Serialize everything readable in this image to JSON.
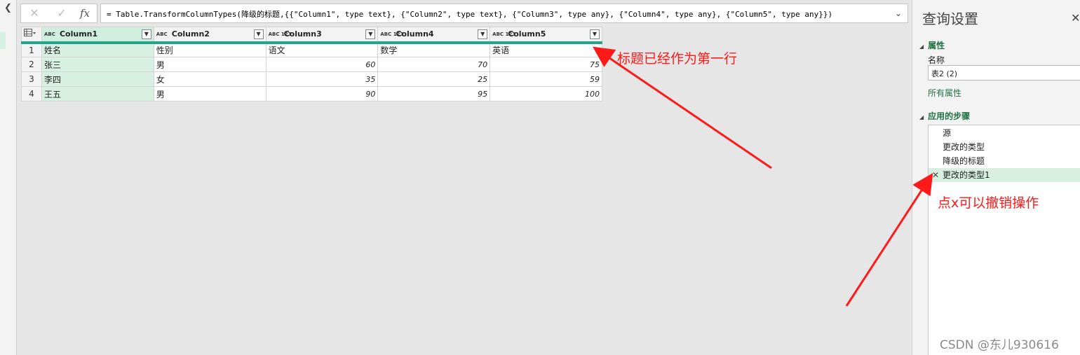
{
  "formula_bar": {
    "cancel_icon": "close-icon",
    "confirm_icon": "check-icon",
    "fx_label": "fx",
    "formula": "= Table.TransformColumnTypes(降级的标题,{{\"Column1\", type text}, {\"Column2\", type text}, {\"Column3\", type any}, {\"Column4\", type any}, {\"Column5\", type any}})"
  },
  "grid": {
    "columns": [
      {
        "type_label": "ABC",
        "name": "Column1"
      },
      {
        "type_label": "ABC",
        "name": "Column2"
      },
      {
        "type_label": "ABC 123",
        "name": "Column3"
      },
      {
        "type_label": "ABC 123",
        "name": "Column4"
      },
      {
        "type_label": "ABC 123",
        "name": "Column5"
      }
    ],
    "rows": [
      {
        "n": "1",
        "cells": [
          "姓名",
          "性别",
          "语文",
          "数学",
          "英语"
        ]
      },
      {
        "n": "2",
        "cells": [
          "张三",
          "男",
          "60",
          "70",
          "75"
        ]
      },
      {
        "n": "3",
        "cells": [
          "李四",
          "女",
          "35",
          "25",
          "59"
        ]
      },
      {
        "n": "4",
        "cells": [
          "王五",
          "男",
          "90",
          "95",
          "100"
        ]
      }
    ]
  },
  "annotations": {
    "header_note": "标题已经作为第一行",
    "undo_note": "点x可以撤销操作",
    "color": "#ff1a1a"
  },
  "settings": {
    "title": "查询设置",
    "properties_label": "属性",
    "name_label": "名称",
    "name_value": "表2 (2)",
    "all_properties": "所有属性",
    "steps_label": "应用的步骤",
    "steps": [
      "源",
      "更改的类型",
      "降级的标题",
      "更改的类型1"
    ]
  },
  "watermark": "CSDN @东儿930616",
  "colors": {
    "accent": "#217346",
    "header_bar": "#1fa68d",
    "selected": "#d7f0e2"
  }
}
